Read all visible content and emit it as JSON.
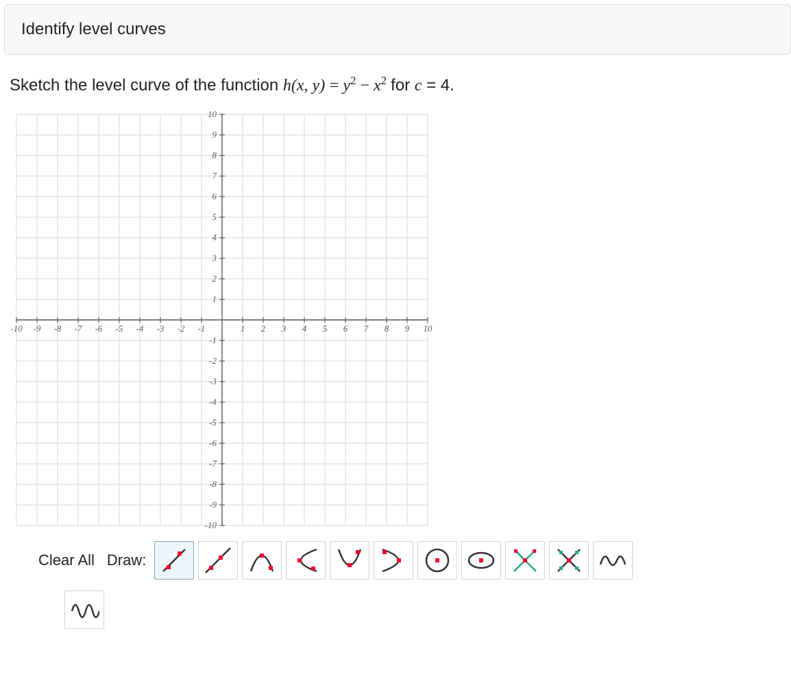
{
  "header": {
    "title": "Identify level curves"
  },
  "question": {
    "prefix": "Sketch the level curve of the function ",
    "func_lhs": "h(x, y)",
    "equals": " = ",
    "func_rhs_y": "y",
    "func_rhs_minus": " − ",
    "func_rhs_x": "x",
    "suffix_for": " for ",
    "c_var": "c",
    "c_eq_val": " = 4."
  },
  "chart_data": {
    "type": "scatter",
    "x_range": [
      -10,
      10
    ],
    "y_range": [
      -10,
      10
    ],
    "x_ticks": [
      -10,
      -9,
      -8,
      -7,
      -6,
      -5,
      -4,
      -3,
      -2,
      -1,
      1,
      2,
      3,
      4,
      5,
      6,
      7,
      8,
      9,
      10
    ],
    "y_ticks": [
      -10,
      -9,
      -8,
      -7,
      -6,
      -5,
      -4,
      -3,
      -2,
      -1,
      1,
      2,
      3,
      4,
      5,
      6,
      7,
      8,
      9,
      10
    ],
    "grid": true,
    "series": []
  },
  "toolbar": {
    "clear_label": "Clear All",
    "draw_label": "Draw:",
    "tools": [
      {
        "name": "line-segment-dots",
        "selected": true
      },
      {
        "name": "ray-dots",
        "selected": false
      },
      {
        "name": "parabola-up",
        "selected": false
      },
      {
        "name": "parabola-left",
        "selected": false
      },
      {
        "name": "parabola-down",
        "selected": false
      },
      {
        "name": "parabola-right",
        "selected": false
      },
      {
        "name": "circle-center",
        "selected": false
      },
      {
        "name": "ellipse-center",
        "selected": false
      },
      {
        "name": "x-shape-red",
        "selected": false
      },
      {
        "name": "x-shape-green",
        "selected": false
      },
      {
        "name": "wave-small",
        "selected": false
      },
      {
        "name": "wave-large",
        "selected": false
      }
    ]
  }
}
